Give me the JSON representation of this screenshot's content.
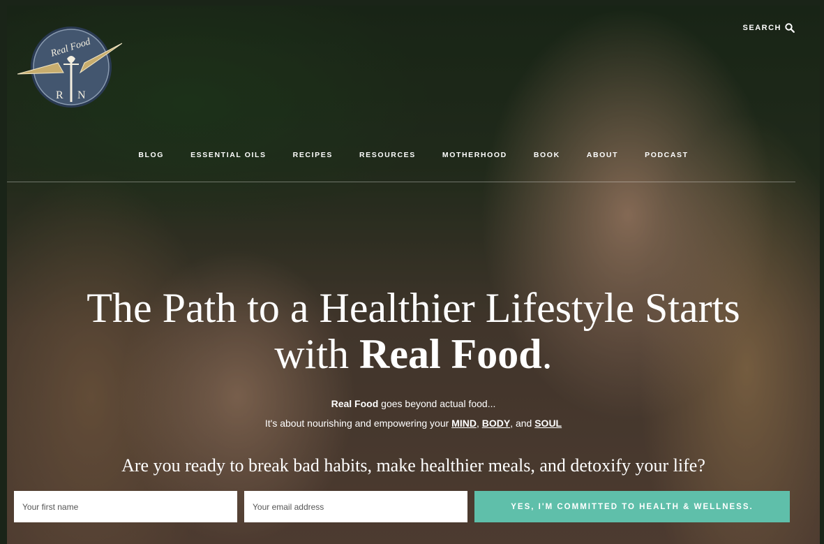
{
  "header": {
    "logo_text_top": "Real Food",
    "logo_left": "R",
    "logo_right": "N",
    "search_label": "SEARCH"
  },
  "nav": {
    "items": [
      "BLOG",
      "ESSENTIAL OILS",
      "RECIPES",
      "RESOURCES",
      "MOTHERHOOD",
      "BOOK",
      "ABOUT",
      "PODCAST"
    ]
  },
  "hero": {
    "headline_line1": "The Path to a Healthier Lifestyle Starts",
    "headline_line2_pre": "with ",
    "headline_line2_bold": "Real Food",
    "headline_line2_post": ".",
    "sub_bold": "Real Food",
    "sub_line1_rest": " goes beyond actual food...",
    "sub_line2_pre": "It's about nourishing and empowering your ",
    "sub_mind": "MIND",
    "sub_comma": ", ",
    "sub_body": "BODY",
    "sub_and": ", and ",
    "sub_soul": "SOUL",
    "question": "Are you ready to break bad habits, make healthier meals, and detoxify your life?"
  },
  "form": {
    "first_name_placeholder": "Your first name",
    "email_placeholder": "Your email address",
    "submit_label": "YES, I'M COMMITTED TO HEALTH & WELLNESS."
  },
  "colors": {
    "accent": "#5fbfaa",
    "logo_navy": "#3d5068",
    "logo_gold": "#c8ad6e"
  },
  "icons": {
    "search": "search-icon",
    "logo": "real-food-rn-logo"
  }
}
